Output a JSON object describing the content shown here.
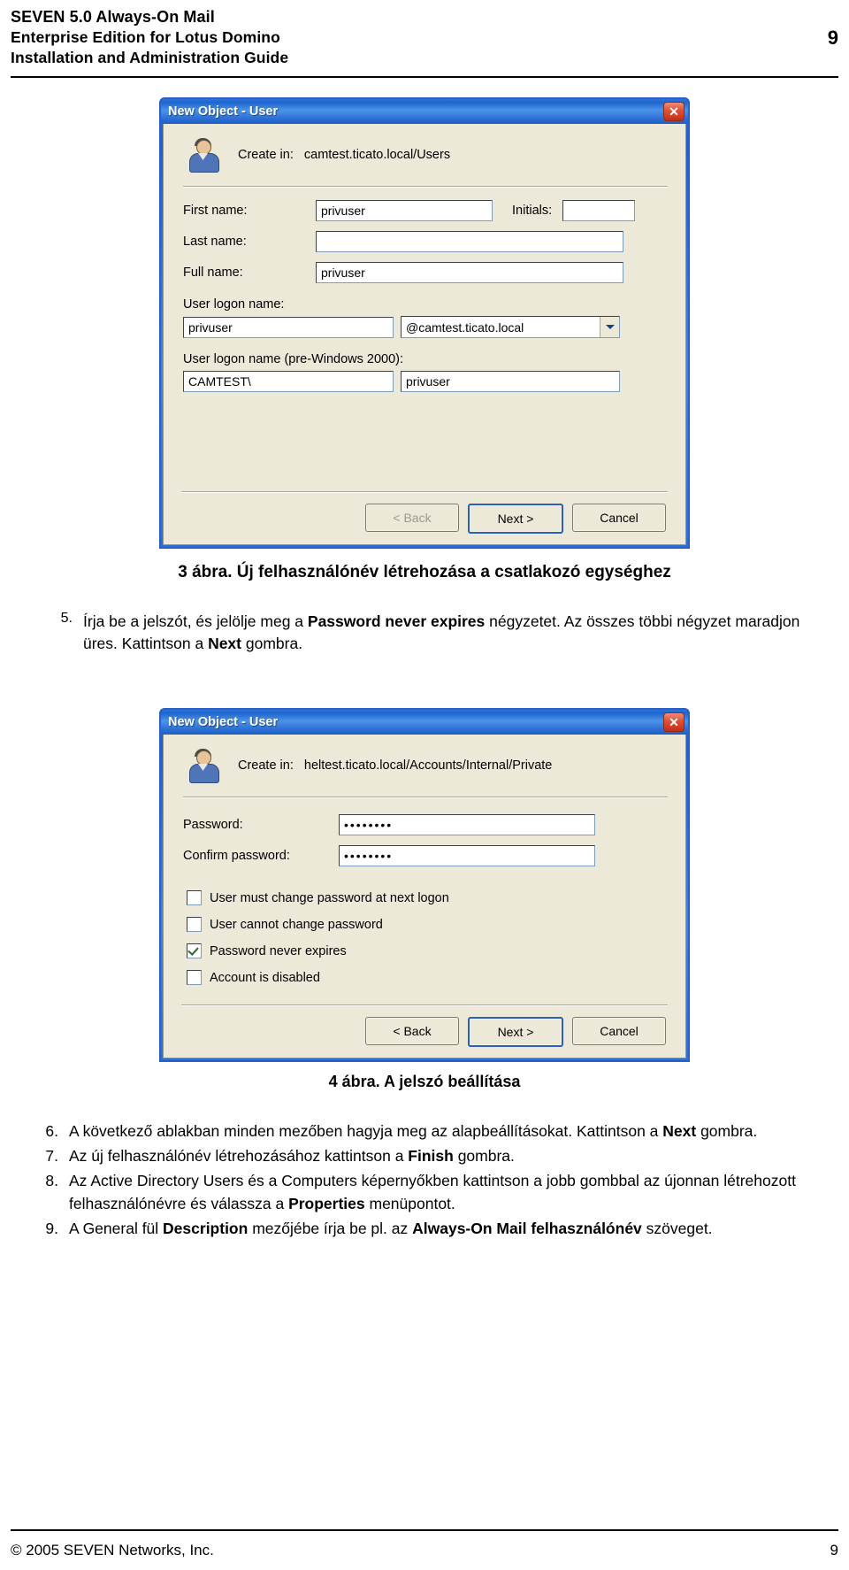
{
  "header": {
    "line1": "SEVEN 5.0 Always-On Mail",
    "line2": "Enterprise Edition for Lotus Domino",
    "line3": "Installation and Administration Guide",
    "page_number": "9"
  },
  "dialog1": {
    "title": "New Object - User",
    "close_label": "✕",
    "create_in_label": "Create in:",
    "create_in_value": "camtest.ticato.local/Users",
    "fields": {
      "first_name_label": "First name:",
      "first_name_value": "privuser",
      "initials_label": "Initials:",
      "initials_value": "",
      "last_name_label": "Last name:",
      "last_name_value": "",
      "full_name_label": "Full name:",
      "full_name_value": "privuser",
      "logon_name_label": "User logon name:",
      "logon_name_value": "privuser",
      "logon_domain_value": "@camtest.ticato.local",
      "pre2000_label": "User logon name (pre-Windows 2000):",
      "pre2000_domain": "CAMTEST\\",
      "pre2000_value": "privuser"
    },
    "buttons": {
      "back": "< Back",
      "next": "Next >",
      "cancel": "Cancel"
    }
  },
  "figure3_caption": "3 ábra. Új felhasználónév létrehozása a csatlakozó egységhez",
  "step5": {
    "number": "5.",
    "text_part1": "Írja be a jelszót, és jelölje meg a ",
    "bold1": "Password never expires",
    "text_part2": " négyzetet. Az összes többi négyzet maradjon üres. Kattintson a ",
    "bold2": "Next",
    "text_part3": " gombra."
  },
  "dialog2": {
    "title": "New Object - User",
    "close_label": "✕",
    "create_in_label": "Create in:",
    "create_in_value": "heltest.ticato.local/Accounts/Internal/Private",
    "fields": {
      "password_label": "Password:",
      "password_value": "••••••••",
      "confirm_label": "Confirm password:",
      "confirm_value": "••••••••"
    },
    "checkboxes": [
      {
        "label": "User must change password at next logon",
        "checked": false
      },
      {
        "label": "User cannot change password",
        "checked": false
      },
      {
        "label": "Password never expires",
        "checked": true
      },
      {
        "label": "Account is disabled",
        "checked": false
      }
    ],
    "buttons": {
      "back": "< Back",
      "next": "Next >",
      "cancel": "Cancel"
    }
  },
  "figure4_caption": "4 ábra. A jelszó beállítása",
  "steps": [
    {
      "number": "6.",
      "segments": [
        {
          "t": "A következő ablakban minden mezőben hagyja meg az alapbeállításokat. Kattintson a ",
          "b": false
        },
        {
          "t": "Next",
          "b": true
        },
        {
          "t": " gombra.",
          "b": false
        }
      ]
    },
    {
      "number": "7.",
      "segments": [
        {
          "t": "Az új felhasználónév létrehozásához kattintson a ",
          "b": false
        },
        {
          "t": "Finish",
          "b": true
        },
        {
          "t": " gombra.",
          "b": false
        }
      ]
    },
    {
      "number": "8.",
      "segments": [
        {
          "t": "Az Active Directory Users és a Computers képernyőkben kattintson a jobb gombbal az újonnan létrehozott felhasználónévre és válassza a ",
          "b": false
        },
        {
          "t": "Properties",
          "b": true
        },
        {
          "t": " menüpontot.",
          "b": false
        }
      ]
    },
    {
      "number": "9.",
      "segments": [
        {
          "t": "A General fül ",
          "b": false
        },
        {
          "t": "Description",
          "b": true
        },
        {
          "t": " mezőjébe írja be pl. az ",
          "b": false
        },
        {
          "t": "Always-On Mail felhasználónév",
          "b": true
        },
        {
          "t": " szöveget.",
          "b": false
        }
      ]
    }
  ],
  "footer": {
    "copyright": "© 2005 SEVEN Networks, Inc.",
    "page_number": "9"
  }
}
